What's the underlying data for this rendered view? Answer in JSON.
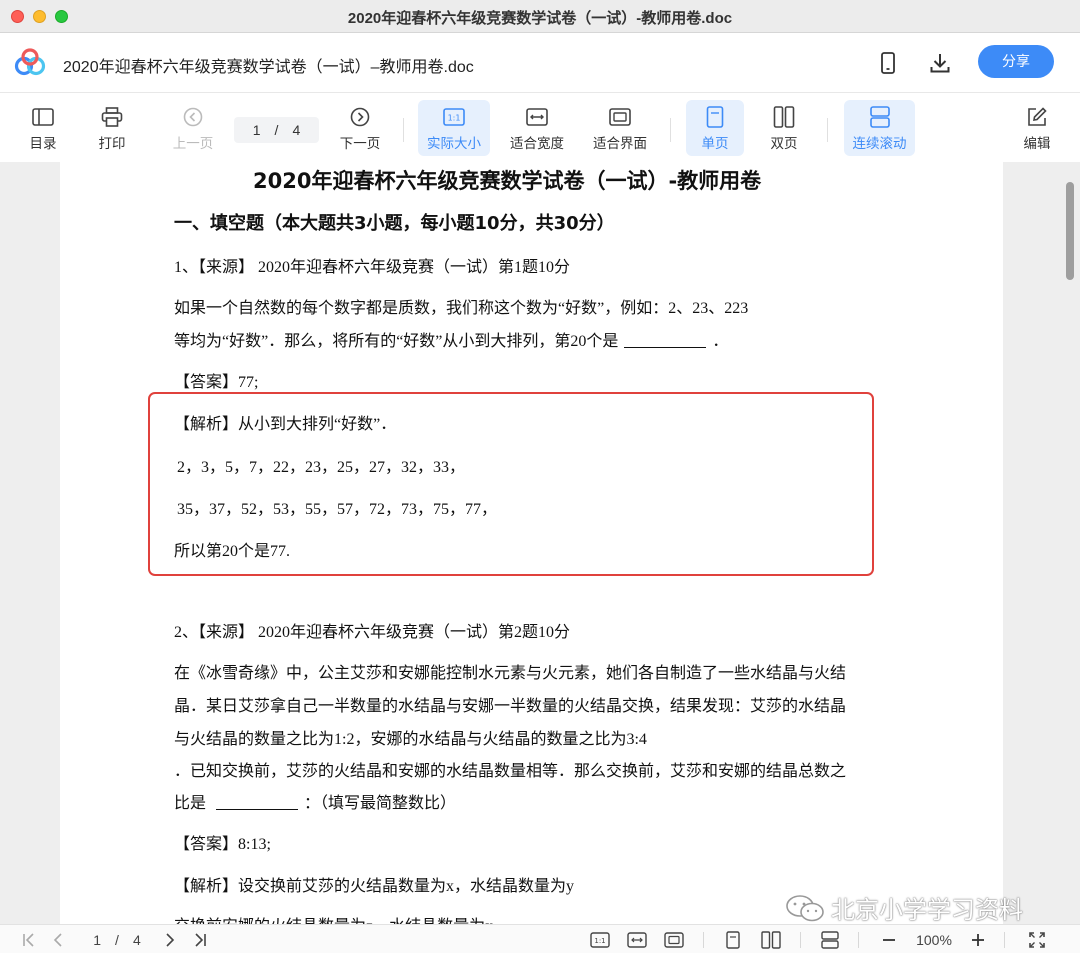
{
  "window": {
    "title": "2020年迎春杯六年级竞赛数学试卷（一试）-教师用卷.doc"
  },
  "header": {
    "doc_title": "2020年迎春杯六年级竞赛数学试卷（一试）–教师用卷.doc",
    "share_label": "分享",
    "icons": [
      "logo-icon",
      "phone-icon",
      "download-icon"
    ]
  },
  "toolbar": {
    "toc": "目录",
    "print": "打印",
    "prev": "上一页",
    "page_current": "1",
    "page_sep": "/",
    "page_total": "4",
    "next": "下一页",
    "actual_size": "实际大小",
    "fit_width": "适合宽度",
    "fit_page": "适合界面",
    "single": "单页",
    "double": "双页",
    "scroll": "连续滚动",
    "edit": "编辑",
    "accent_color": "#3d8bf7"
  },
  "document": {
    "title": "2020年迎春杯六年级竞赛数学试卷（一试）-教师用卷",
    "section": "一、填空题（本大题共3小题，每小题10分，共30分）",
    "q1": {
      "source": "1、【来源】 2020年迎春杯六年级竞赛（一试）第1题10分",
      "line1": "如果一个自然数的每个数字都是质数，我们称这个数为“好数”，例如：2、23、223",
      "line2a": "等均为“好数”．那么，将所有的“好数”从小到大排列，第20个是",
      "line2b": "．",
      "answer": "【答案】77;",
      "analysis_head": "【解析】从小到大排列“好数”．",
      "analysis_l1": "2，3，5，7，22，23，25，27，32，33，",
      "analysis_l2": "35，37，52，53，55，57，72，73，75，77，",
      "analysis_l3": "所以第20个是77."
    },
    "q2": {
      "source": "2、【来源】 2020年迎春杯六年级竞赛（一试）第2题10分",
      "line1": "在《冰雪奇缘》中，公主艾莎和安娜能控制水元素与火元素，她们各自制造了一些水结晶与火结",
      "line2": "晶．某日艾莎拿自己一半数量的水结晶与安娜一半数量的火结晶交换，结果发现：艾莎的水结晶",
      "line3": "与火结晶的数量之比为1:2，安娜的水结晶与火结晶的数量之比为3:4",
      "line4": "．已知交换前，艾莎的火结晶和安娜的水结晶数量相等．那么交换前，艾莎和安娜的结晶总数之",
      "line5a": "比是",
      "line5b": "：（填写最简整数比）",
      "answer": "【答案】8:13;",
      "analysis_head": "【解析】设交换前艾莎的火结晶数量为x，水结晶数量为y",
      "analysis_l1": "交换前安娜的火结晶数量为z，水结晶数量为x"
    },
    "highlight_color": "#e0413c"
  },
  "watermark": "北京小学学习资料",
  "statusbar": {
    "page_current": "1",
    "page_sep": "/",
    "page_total": "4",
    "zoom": "100%"
  }
}
